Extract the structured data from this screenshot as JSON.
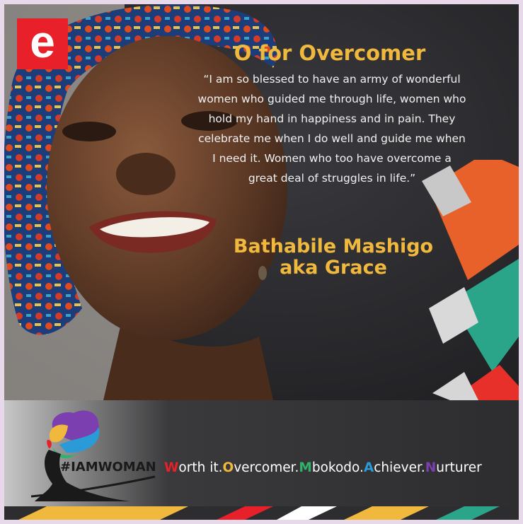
{
  "logo": {
    "letter": "e",
    "color": "#e8202a"
  },
  "title": "O for Overcomer",
  "quote": "“I am so blessed to have an army of wonderful women who guided me through life, women who hold my hand in happiness and in pain. They celebrate me when I do well and guide me when I need it. Women who too have overcome a great deal of struggles in life.”",
  "name_line1": "Bathabile Mashigo",
  "name_line2": "aka Grace",
  "hashtag": "#IAMWOMAN",
  "tagline": [
    {
      "initial": "W",
      "rest": "orth it.",
      "color": "#e8202a"
    },
    {
      "initial": "O",
      "rest": "vercomer.",
      "color": "#f0b93d"
    },
    {
      "initial": "M",
      "rest": "bokodo.",
      "color": "#2fb36b"
    },
    {
      "initial": "A",
      "rest": "chiever.",
      "color": "#2a9bd6"
    },
    {
      "initial": "N",
      "rest": "urturer",
      "color": "#7b3fb0"
    }
  ],
  "colors": {
    "accent": "#f0b93d",
    "background": "#2a2a2d"
  }
}
